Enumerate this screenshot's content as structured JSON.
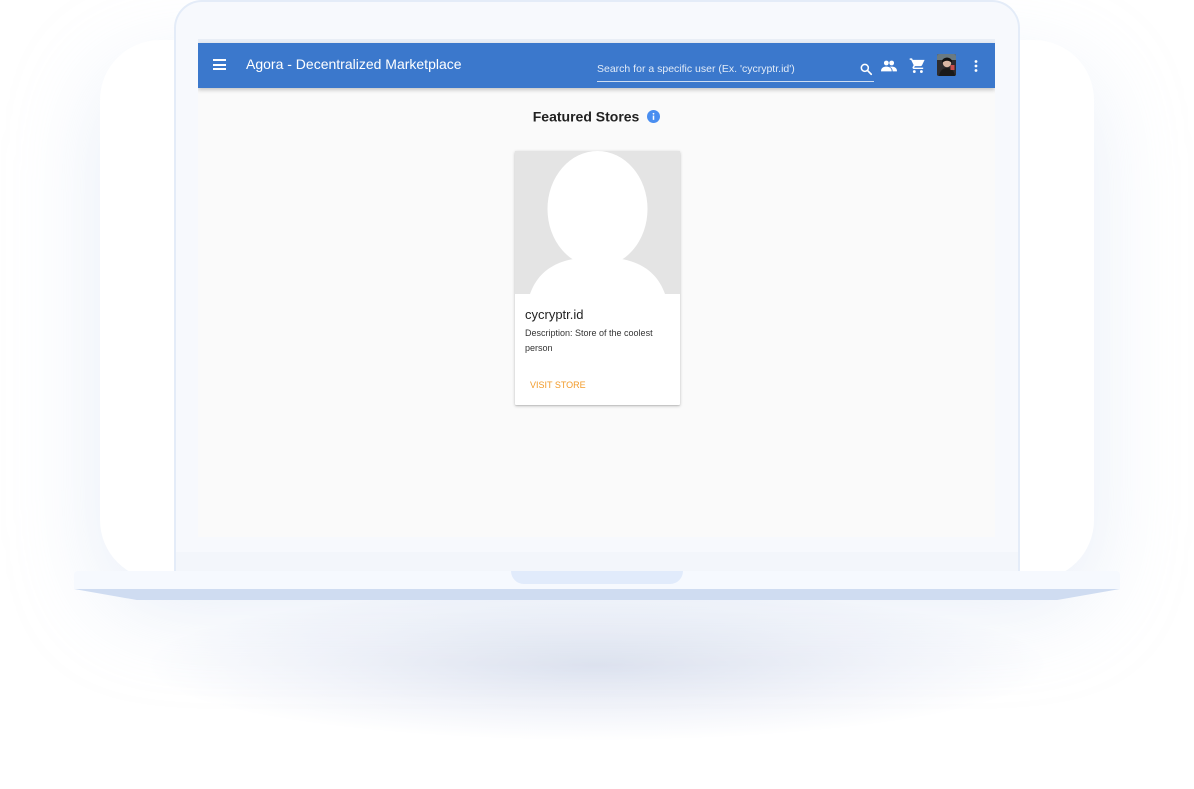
{
  "app": {
    "title": "Agora - Decentralized Marketplace"
  },
  "header": {
    "menu_icon": "menu-icon",
    "search": {
      "placeholder": "Search for a specific user (Ex. 'cycryptr.id')",
      "value": ""
    },
    "icons": [
      "search-icon",
      "people-icon",
      "shopping-cart-icon",
      "avatar",
      "more-vert-icon"
    ]
  },
  "main": {
    "title": "Featured Stores",
    "info_icon": "info-icon",
    "stores": [
      {
        "name": "cycryptr.id",
        "description": "Description: Store of the coolest person",
        "action_label": "VISIT STORE"
      }
    ]
  },
  "colors": {
    "app_bar": "#3b78cc",
    "accent": "#f29b2a",
    "info": "#4a8ef0",
    "background": "#fafafa"
  }
}
